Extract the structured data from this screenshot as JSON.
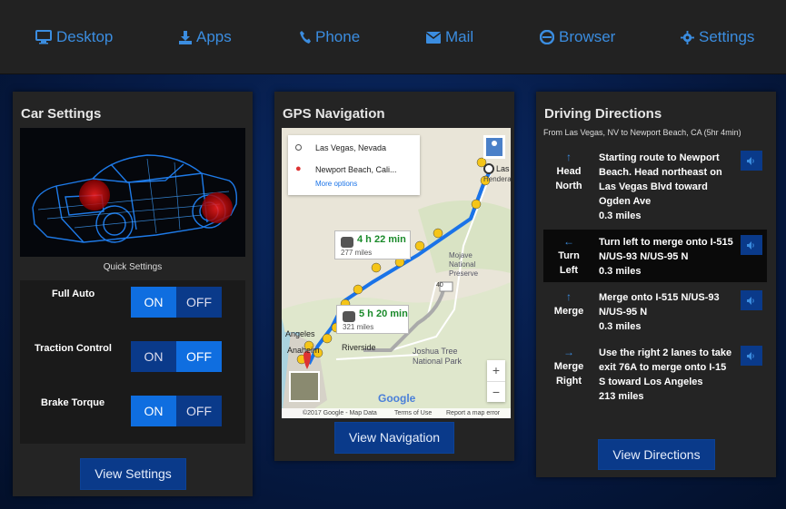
{
  "nav": {
    "items": [
      {
        "label": "Desktop",
        "icon": "monitor-icon"
      },
      {
        "label": "Apps",
        "icon": "download-icon"
      },
      {
        "label": "Phone",
        "icon": "phone-icon"
      },
      {
        "label": "Mail",
        "icon": "mail-icon"
      },
      {
        "label": "Browser",
        "icon": "browser-icon"
      },
      {
        "label": "Settings",
        "icon": "gear-icon"
      }
    ]
  },
  "car": {
    "title": "Car Settings",
    "quick_label": "Quick Settings",
    "settings": [
      {
        "label": "Full Auto",
        "on": "ON",
        "off": "OFF",
        "state": "on"
      },
      {
        "label": "Traction Control",
        "on": "ON",
        "off": "OFF",
        "state": "off"
      },
      {
        "label": "Brake Torque",
        "on": "ON",
        "off": "OFF",
        "state": "on"
      }
    ],
    "button": "View Settings"
  },
  "gps": {
    "title": "GPS Navigation",
    "origin": "Las Vegas, Nevada",
    "destination": "Newport Beach, Cali...",
    "more_options": "More options",
    "route1_time": "4 h 22 min",
    "route1_dist": "277 miles",
    "route2_time": "5 h 20 min",
    "route2_dist": "321 miles",
    "labels": {
      "las": "Las",
      "henderson": "Hendera",
      "mojave": "Mojave",
      "national": "National",
      "preserve": "Preserve",
      "joshua1": "Joshua Tree",
      "joshua2": "National Park",
      "riverside": "Riverside",
      "angeles": "Angeles",
      "anaheim": "Anaheim",
      "road40": "40"
    },
    "google": "Google",
    "footer": [
      "©2017 Google - Map Data",
      "Terms of Use",
      "Report a map error"
    ],
    "zoom_in": "+",
    "zoom_out": "−",
    "button": "View Navigation"
  },
  "directions": {
    "title": "Driving Directions",
    "subtitle": "From Las Vegas, NV to Newport Beach, CA (5hr 4min)",
    "steps": [
      {
        "arrow": "↑",
        "label1": "Head",
        "label2": "North",
        "text": "Starting route to Newport Beach. Head northeast on Las Vegas Blvd toward Ogden Ave",
        "dist": "0.3 miles"
      },
      {
        "arrow": "←",
        "label1": "Turn",
        "label2": "Left",
        "text": "Turn left to merge onto I-515 N/US-93 N/US-95 N",
        "dist": "0.3 miles"
      },
      {
        "arrow": "↑",
        "label1": "Merge",
        "label2": "",
        "text": "Merge onto I-515 N/US-93 N/US-95 N",
        "dist": "0.3 miles"
      },
      {
        "arrow": "→",
        "label1": "Merge",
        "label2": "Right",
        "text": "Use the right 2 lanes to take exit 76A to merge onto I-15 S toward Los Angeles",
        "dist": "213 miles"
      }
    ],
    "button": "View Directions"
  },
  "colors": {
    "accent": "#3b8de0",
    "toggle_active": "#0f6ee0",
    "toggle_inactive": "#0a3a8a",
    "panel": "#242424"
  }
}
